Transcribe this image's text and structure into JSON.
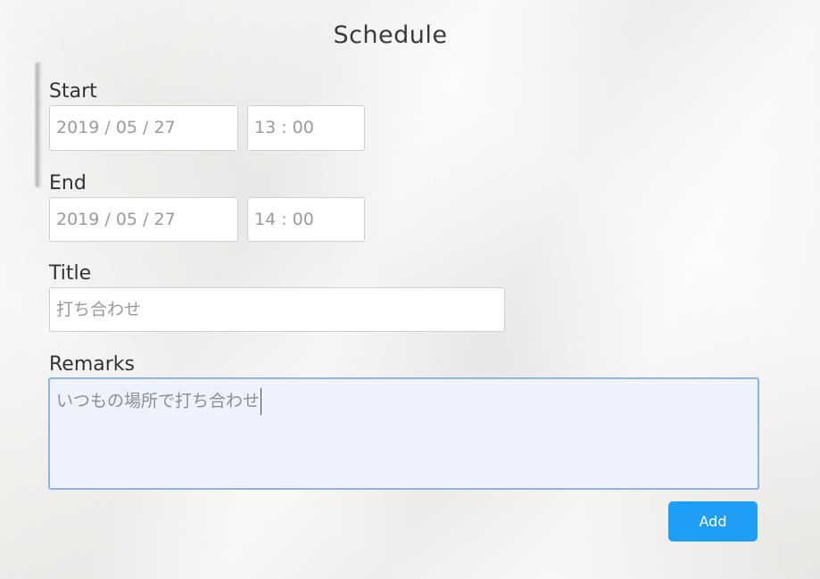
{
  "page": {
    "title": "Schedule"
  },
  "form": {
    "start": {
      "label": "Start",
      "date": "2019 / 05 / 27",
      "time": "13 : 00"
    },
    "end": {
      "label": "End",
      "date": "2019 / 05 / 27",
      "time": "14 : 00"
    },
    "title": {
      "label": "Title",
      "value": "打ち合わせ"
    },
    "remarks": {
      "label": "Remarks",
      "value": "いつもの場所で打ち合わせ"
    },
    "add_label": "Add"
  },
  "colors": {
    "accent": "#1e9ef4",
    "focus_border": "#8ab4ea",
    "focus_background": "#edf2fc"
  }
}
